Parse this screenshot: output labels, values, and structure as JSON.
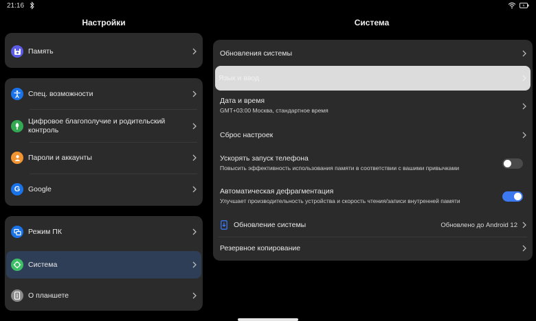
{
  "status_bar": {
    "time": "21:16",
    "icons": [
      "bluetooth-icon",
      "wifi-icon",
      "battery-icon"
    ]
  },
  "left_panel": {
    "title": "Настройки",
    "items": [
      {
        "label": "Память",
        "icon": "memory-icon",
        "color": "#5d5ce6"
      },
      {
        "label": "Спец. возможности",
        "icon": "accessibility-icon",
        "color": "#1a73e8"
      },
      {
        "label": "Цифровое благополучие и родительский контроль",
        "icon": "wellbeing-icon",
        "color": "#34a853"
      },
      {
        "label": "Пароли и аккаунты",
        "icon": "key-icon",
        "color": "#f29431"
      },
      {
        "label": "Google",
        "icon": "google-icon",
        "color": "#1a73e8"
      },
      {
        "label": "Режим ПК",
        "icon": "pc-mode-icon",
        "color": "#1a73e8"
      },
      {
        "label": "Система",
        "icon": "system-icon",
        "color": "#3cbf67"
      },
      {
        "label": "О планшете",
        "icon": "tablet-info-icon",
        "color": "#8a8a8a"
      }
    ],
    "selected": "Система"
  },
  "right_panel": {
    "title": "Система",
    "items": {
      "updates": "Обновления системы",
      "language": "Язык и ввод",
      "datetime": {
        "label": "Дата и время",
        "sub": "GMT+03:00 Москва, стандартное время"
      },
      "reset": "Сброс настроек",
      "boost": {
        "label": "Ускорять запуск телефона",
        "sub": "Повысить эффективность использования памяти в соответствии с вашими привычками",
        "enabled": false
      },
      "defrag": {
        "label": "Автоматическая дефрагментация",
        "sub": "Улучшает производительность устройства и скорость чтения/записи внутренней памяти",
        "enabled": true
      },
      "system_update": {
        "label": "Обновление системы",
        "value": "Обновлено до Android 12"
      },
      "backup": "Резервное копирование"
    }
  },
  "colors": {
    "card_bg": "#2b2b2b",
    "selected_bg": "#2e3e57",
    "highlight_bg": "#dcdcdc",
    "toggle_on": "#3c78f0",
    "toggle_off": "#4a4a4a"
  }
}
